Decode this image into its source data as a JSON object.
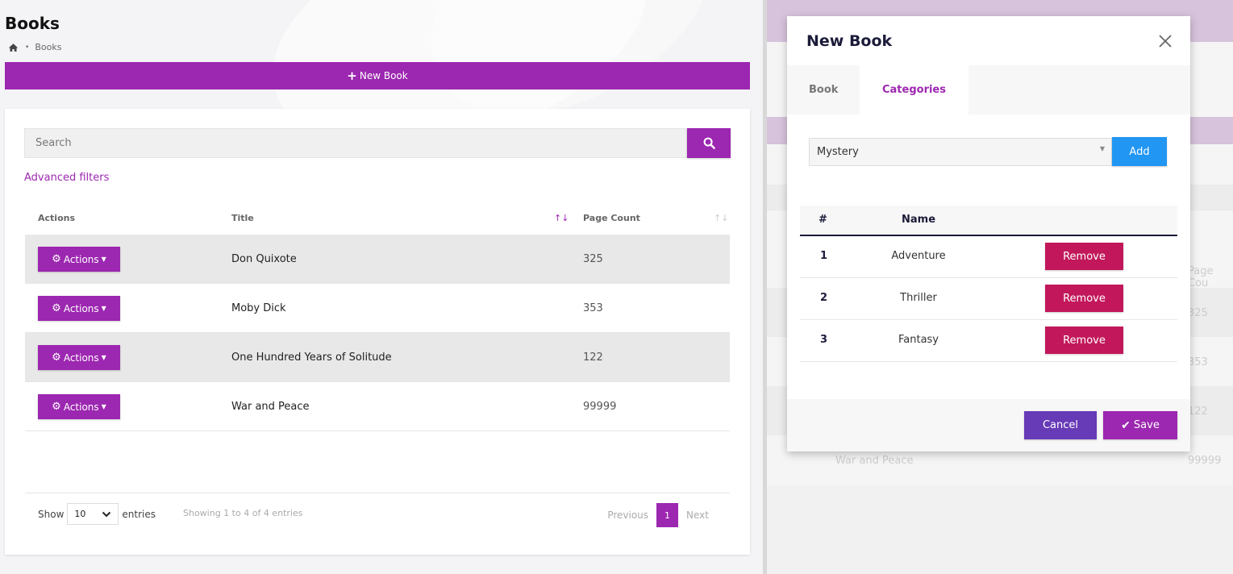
{
  "page": {
    "title": "Books",
    "breadcrumb": {
      "icon": "home-icon",
      "separator": "•",
      "current": "Books"
    },
    "new_book_button": {
      "icon": "plus-icon",
      "label": "New Book"
    }
  },
  "search": {
    "placeholder": "Search",
    "button_icon": "search-icon"
  },
  "advanced_filters": "Advanced filters",
  "table": {
    "columns": [
      "Actions",
      "Title",
      "Page Count"
    ],
    "sort": {
      "title": "ascending",
      "page_count": "none"
    },
    "rows": [
      {
        "action_label": "Actions",
        "title": "Don Quixote",
        "page_count": "325"
      },
      {
        "action_label": "Actions",
        "title": "Moby Dick",
        "page_count": "353"
      },
      {
        "action_label": "Actions",
        "title": "One Hundred Years of Solitude",
        "page_count": "122"
      },
      {
        "action_label": "Actions",
        "title": "War and Peace",
        "page_count": "99999"
      }
    ]
  },
  "footer": {
    "show_label": "Show",
    "entries_value": "10",
    "entries_label": "entries",
    "showing_text": "Showing 1 to 4 of 4 entries",
    "previous": "Previous",
    "current_page": "1",
    "next": "Next"
  },
  "background": {
    "ghost_header": "Page Cou",
    "ghost_counts": [
      "325",
      "353",
      "122",
      "99999"
    ],
    "ghost_title": "War and Peace"
  },
  "modal": {
    "title": "New Book",
    "tabs": [
      "Book",
      "Categories"
    ],
    "active_tab": "Categories",
    "category_select_value": "Mystery",
    "add_label": "Add",
    "table": {
      "columns": [
        "#",
        "Name"
      ],
      "rows": [
        {
          "num": "1",
          "name": "Adventure",
          "action": "Remove"
        },
        {
          "num": "2",
          "name": "Thriller",
          "action": "Remove"
        },
        {
          "num": "3",
          "name": "Fantasy",
          "action": "Remove"
        }
      ]
    },
    "cancel_label": "Cancel",
    "save_label": "Save"
  },
  "colors": {
    "primary": "#9c27b0",
    "info": "#2196f3",
    "danger": "#c2185b",
    "secondary": "#673ab7",
    "dark_text": "#1b1b3a"
  }
}
